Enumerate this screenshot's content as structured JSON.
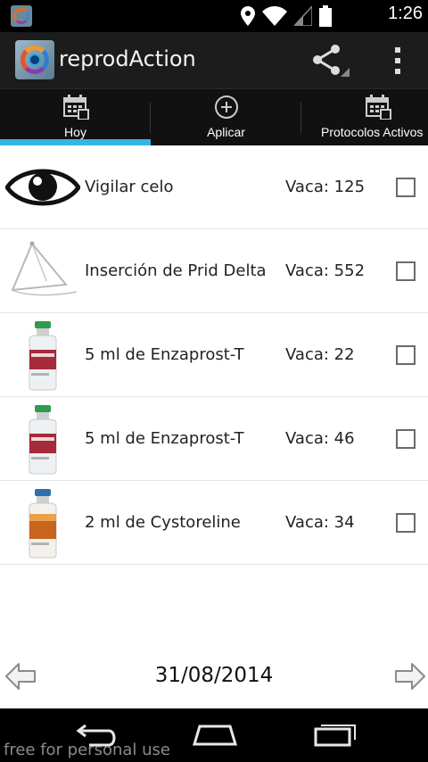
{
  "status_bar": {
    "time": "1:26",
    "icons": [
      "app-notification-icon",
      "location-icon",
      "wifi-icon",
      "cell-signal-icon",
      "battery-icon"
    ]
  },
  "action_bar": {
    "title": "reprodAction",
    "share_icon": "share-icon",
    "overflow_icon": "overflow-menu-icon"
  },
  "tabs": [
    {
      "label": "Hoy",
      "icon": "calendar-icon",
      "active": true
    },
    {
      "label": "Aplicar",
      "icon": "add-circle-icon",
      "active": false
    },
    {
      "label": "Protocolos Activos",
      "icon": "calendar-icon",
      "active": false
    }
  ],
  "tasks": [
    {
      "task": "Vigilar celo",
      "cow": "Vaca: 125",
      "icon": "eye-icon",
      "checked": false
    },
    {
      "task": "Inserción de Prid Delta",
      "cow": "Vaca: 552",
      "icon": "prid-device-icon",
      "checked": false
    },
    {
      "task": "5 ml de Enzaprost-T",
      "cow": "Vaca: 22",
      "icon": "enzaprost-vial-icon",
      "checked": false
    },
    {
      "task": "5 ml de Enzaprost-T",
      "cow": "Vaca: 46",
      "icon": "enzaprost-vial-icon",
      "checked": false
    },
    {
      "task": "2 ml de Cystoreline",
      "cow": "Vaca: 34",
      "icon": "cystoreline-vial-icon",
      "checked": false
    }
  ],
  "date_nav": {
    "date": "31/08/2014",
    "prev_icon": "arrow-left-icon",
    "next_icon": "arrow-right-icon"
  },
  "system_nav": {
    "watermark": "free for personal use"
  },
  "colors": {
    "tab_indicator": "#33b5e5",
    "action_bar": "#1c1c1c",
    "tab_bar": "#111111"
  }
}
